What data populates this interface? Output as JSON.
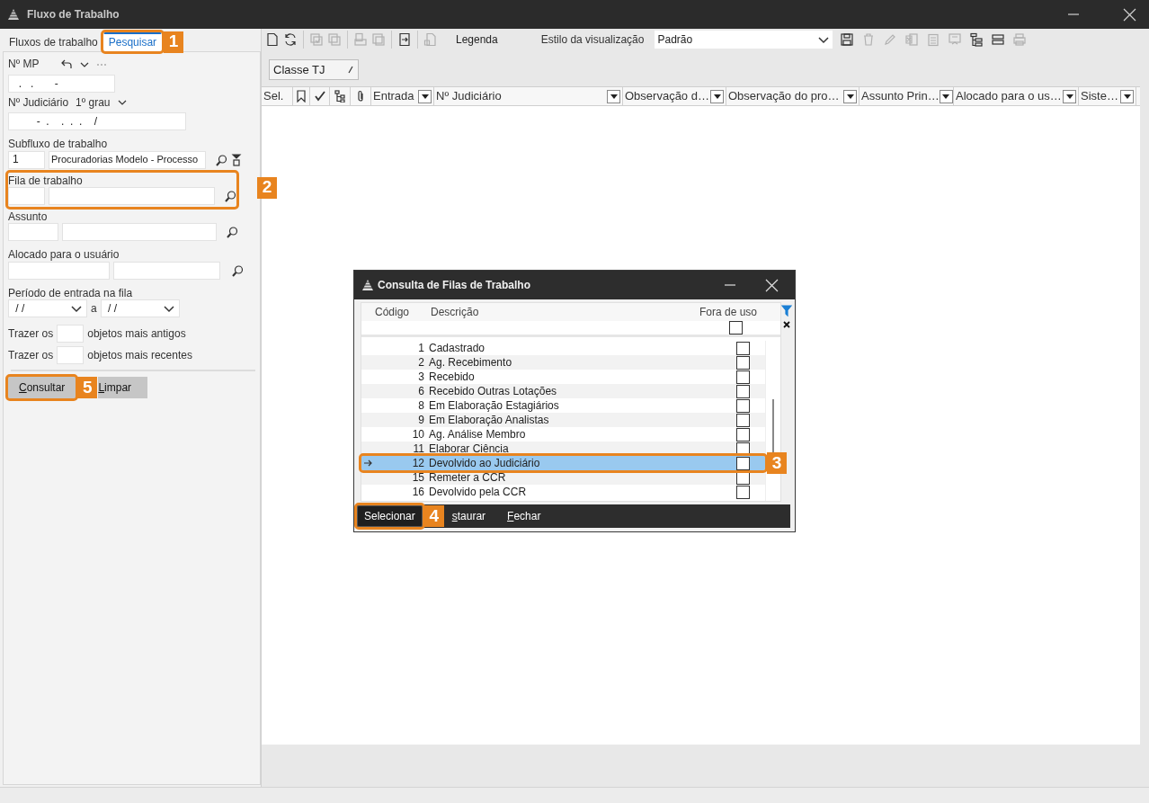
{
  "window": {
    "title": "Fluxo de Trabalho"
  },
  "tabs": [
    {
      "label": "Fluxos de trabalho",
      "selected": false
    },
    {
      "label": "Pesquisar",
      "selected": true,
      "callout": "1"
    }
  ],
  "search_form": {
    "mp": {
      "label": "Nº MP",
      "value": "  .   .       -"
    },
    "judicial": {
      "label": "Nº Judiciário",
      "degree": "1º grau",
      "value": "        -  .    .  .  .    /"
    },
    "subflow": {
      "label": "Subfluxo de trabalho",
      "code": "1",
      "description": "Procuradorias Modelo - Processo"
    },
    "queue": {
      "label": "Fila de trabalho",
      "callout": "2"
    },
    "subject": {
      "label": "Assunto"
    },
    "user": {
      "label": "Alocado para o usuário"
    },
    "period": {
      "label": "Período de entrada na fila",
      "from": " / /",
      "separator": "a",
      "to": " / /"
    },
    "oldest": {
      "prefix": "Trazer os",
      "suffix": "objetos mais antigos"
    },
    "newest": {
      "prefix": "Trazer os",
      "suffix": "objetos mais recentes"
    },
    "buttons": [
      {
        "label": "Consultar",
        "callout": "5"
      },
      {
        "label": "Limpar"
      }
    ]
  },
  "toolbar": {
    "left_tools": [
      {
        "kind": "new-document",
        "disabled": false
      },
      {
        "kind": "refresh",
        "disabled": false
      },
      {
        "kind": "check-copy",
        "disabled": true
      },
      {
        "kind": "copy",
        "disabled": true
      },
      {
        "kind": "print-copy",
        "disabled": true
      },
      {
        "kind": "save-copy",
        "disabled": true
      },
      {
        "kind": "export",
        "disabled": false
      },
      {
        "kind": "report",
        "disabled": true
      }
    ],
    "legend": "Legenda",
    "view_style": {
      "label": "Estilo da visualização",
      "value": "Padrão"
    },
    "right_tools": [
      {
        "kind": "save",
        "disabled": false
      },
      {
        "kind": "delete",
        "disabled": true
      },
      {
        "kind": "edit",
        "disabled": true
      },
      {
        "kind": "excel",
        "disabled": true
      },
      {
        "kind": "clipboard",
        "disabled": true
      },
      {
        "kind": "board",
        "disabled": true
      },
      {
        "kind": "tree",
        "disabled": false
      },
      {
        "kind": "columns",
        "disabled": false
      },
      {
        "kind": "print",
        "disabled": true
      }
    ]
  },
  "grid": {
    "group_chip": "Classe TJ",
    "columns": [
      {
        "kind": "text",
        "label": "Sel.",
        "filter": false
      },
      {
        "kind": "marker"
      },
      {
        "kind": "check"
      },
      {
        "kind": "tree"
      },
      {
        "kind": "attachment"
      },
      {
        "kind": "text",
        "label": "Entrada",
        "filter": true
      },
      {
        "kind": "text",
        "label": "Nº Judiciário",
        "filter": true
      },
      {
        "kind": "text",
        "label": "Observação d…",
        "filter": true
      },
      {
        "kind": "text",
        "label": "Observação do pro…",
        "filter": true
      },
      {
        "kind": "text",
        "label": "Assunto Prin…",
        "filter": true
      },
      {
        "kind": "text",
        "label": "Alocado para o us…",
        "filter": true
      },
      {
        "kind": "text",
        "label": "Siste…",
        "filter": true
      }
    ]
  },
  "dialog": {
    "title": "Consulta de Filas de Trabalho",
    "columns": [
      "Código",
      "Descrição",
      "Fora de uso"
    ],
    "filter_out_of_use_checked": false,
    "rows": [
      {
        "code": "1",
        "description": "Cadastrado",
        "out_of_use": false,
        "selected": false
      },
      {
        "code": "2",
        "description": "Ag. Recebimento",
        "out_of_use": false,
        "selected": false
      },
      {
        "code": "3",
        "description": "Recebido",
        "out_of_use": false,
        "selected": false
      },
      {
        "code": "6",
        "description": "Recebido Outras Lotações",
        "out_of_use": false,
        "selected": false
      },
      {
        "code": "8",
        "description": "Em Elaboração Estagiários",
        "out_of_use": false,
        "selected": false
      },
      {
        "code": "9",
        "description": "Em Elaboração Analistas",
        "out_of_use": false,
        "selected": false
      },
      {
        "code": "10",
        "description": "Ag. Análise Membro",
        "out_of_use": false,
        "selected": false
      },
      {
        "code": "11",
        "description": "Elaborar Ciência",
        "out_of_use": false,
        "selected": false
      },
      {
        "code": "12",
        "description": "Devolvido ao Judiciário",
        "out_of_use": false,
        "selected": true,
        "callout": "3"
      },
      {
        "code": "15",
        "description": "Remeter a CCR",
        "out_of_use": false,
        "selected": false
      },
      {
        "code": "16",
        "description": "Devolvido pela CCR",
        "out_of_use": false,
        "selected": false
      }
    ],
    "buttons": [
      {
        "label": "Selecionar",
        "callout": "4"
      },
      {
        "label": "staurar"
      },
      {
        "label": "Fechar"
      }
    ]
  }
}
